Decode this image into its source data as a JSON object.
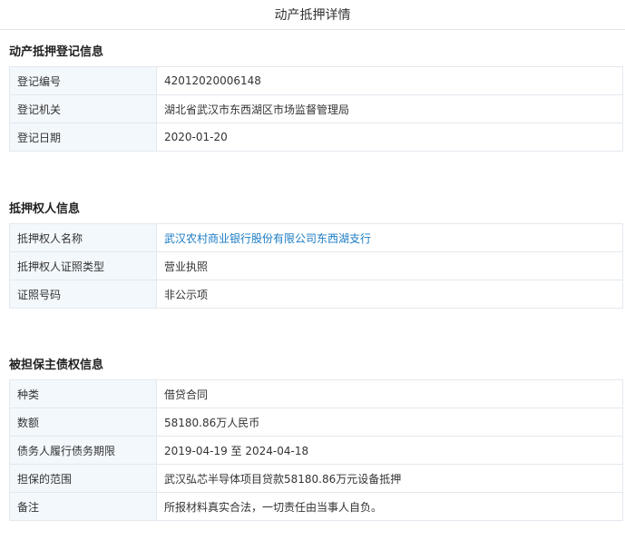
{
  "page": {
    "title": "动产抵押详情"
  },
  "registration": {
    "title": "动产抵押登记信息",
    "rows": [
      {
        "label": "登记编号",
        "value": "42012020006148"
      },
      {
        "label": "登记机关",
        "value": "湖北省武汉市东西湖区市场监督管理局"
      },
      {
        "label": "登记日期",
        "value": "2020-01-20"
      }
    ]
  },
  "mortgagee": {
    "title": "抵押权人信息",
    "rows": [
      {
        "label": "抵押权人名称",
        "value": "武汉农村商业银行股份有限公司东西湖支行"
      },
      {
        "label": "抵押权人证照类型",
        "value": "营业执照"
      },
      {
        "label": "证照号码",
        "value": "非公示项"
      }
    ]
  },
  "secured_claim": {
    "title": "被担保主债权信息",
    "rows": [
      {
        "label": "种类",
        "value": "借贷合同"
      },
      {
        "label": "数额",
        "value": "58180.86万人民币"
      },
      {
        "label": "债务人履行债务期限",
        "value": "2019-04-19 至 2024-04-18"
      },
      {
        "label": "担保的范围",
        "value": "武汉弘芯半导体项目贷款58180.86万元设备抵押"
      },
      {
        "label": "备注",
        "value": "所报材料真实合法，一切责任由当事人自负。"
      }
    ]
  },
  "colors": {
    "link": "#1a7bc4",
    "label_bg": "#f3f8fd",
    "border": "#e3e8ee"
  }
}
